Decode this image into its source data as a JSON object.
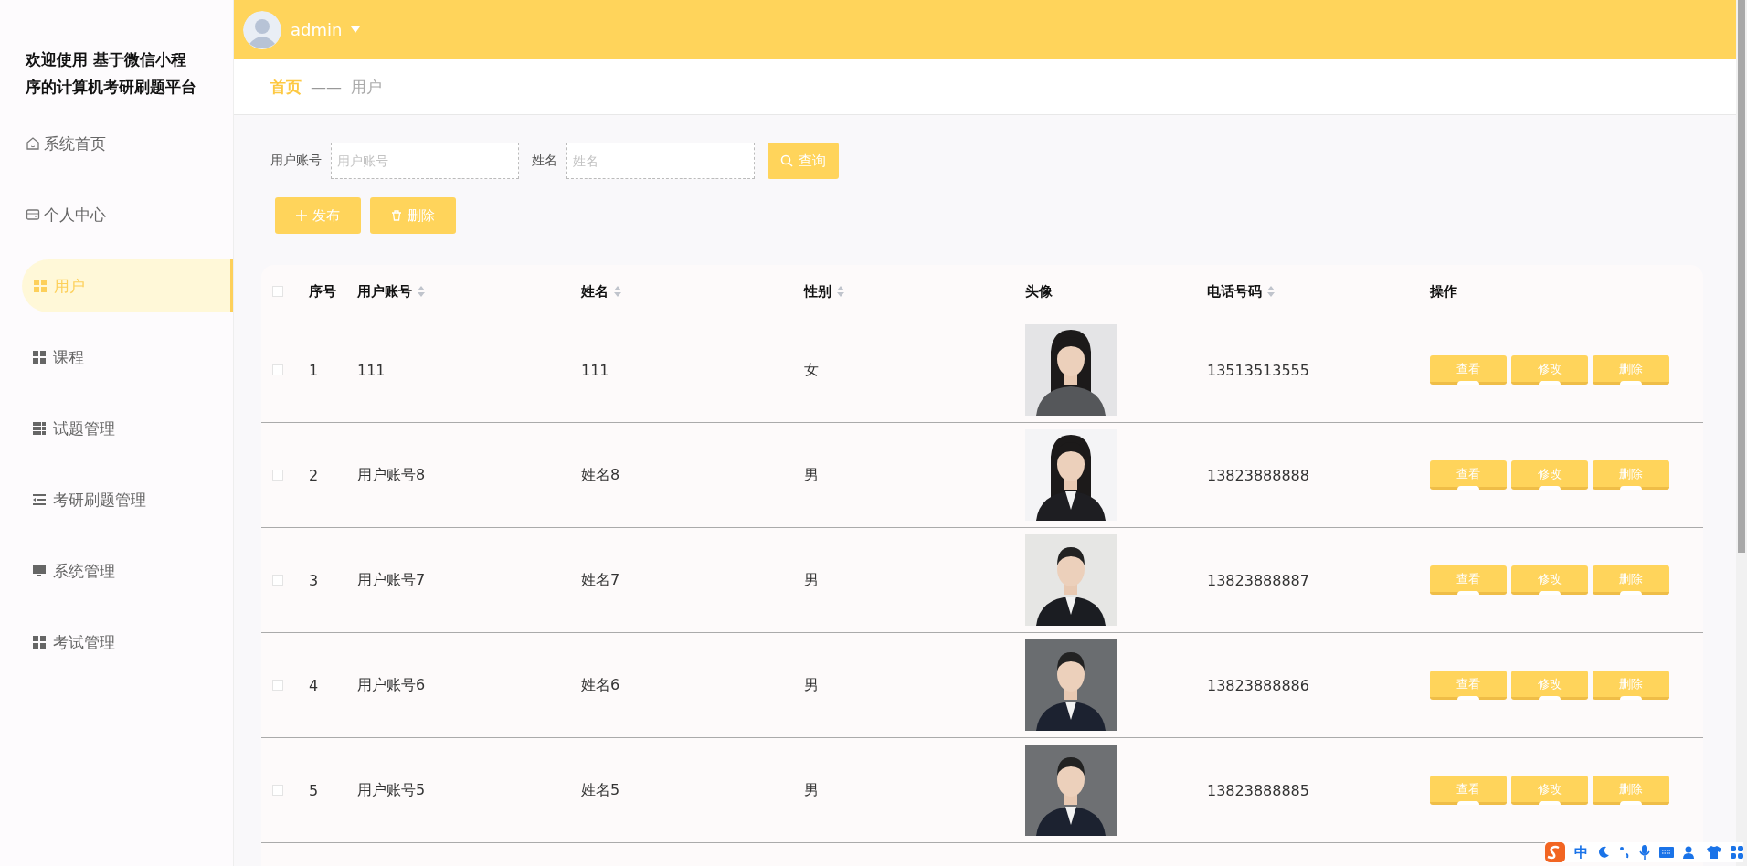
{
  "brand": {
    "title": "欢迎使用 基于微信小程序的计算机考研刷题平台"
  },
  "sidebar": {
    "items": [
      {
        "label": "系统首页",
        "kind": "home",
        "selected": false
      },
      {
        "label": "个人中心",
        "kind": "card",
        "selected": false
      },
      {
        "label": "用户",
        "kind": "grid",
        "selected": true
      },
      {
        "label": "课程",
        "kind": "grid",
        "selected": false
      },
      {
        "label": "试题管理",
        "kind": "grid9",
        "selected": false
      },
      {
        "label": "考研刷题管理",
        "kind": "list",
        "selected": false
      },
      {
        "label": "系统管理",
        "kind": "monitor",
        "selected": false
      },
      {
        "label": "考试管理",
        "kind": "grid",
        "selected": false
      }
    ]
  },
  "header": {
    "user": "admin"
  },
  "breadcrumb": {
    "home": "首页",
    "separator": "——",
    "current": "用户"
  },
  "search": {
    "fields": [
      {
        "label": "用户账号",
        "placeholder": "用户账号"
      },
      {
        "label": "姓名",
        "placeholder": "姓名"
      }
    ],
    "button": "查询"
  },
  "actions": [
    {
      "kind": "add",
      "label": "发布"
    },
    {
      "kind": "delete",
      "label": "删除"
    }
  ],
  "table": {
    "select_all": {
      "checked": false
    },
    "columns": [
      {
        "label": "序号",
        "sortable": false
      },
      {
        "label": "用户账号",
        "sortable": true
      },
      {
        "label": "姓名",
        "sortable": true
      },
      {
        "label": "性别",
        "sortable": true
      },
      {
        "label": "头像",
        "sortable": false
      },
      {
        "label": "电话号码",
        "sortable": true
      },
      {
        "label": "操作",
        "sortable": false
      }
    ],
    "rows": [
      {
        "checked": false,
        "index": "1",
        "account": "111",
        "name": "111",
        "gender": "女",
        "phone": "13513513555",
        "actions": [
          "查看",
          "修改",
          "删除"
        ]
      },
      {
        "checked": false,
        "index": "2",
        "account": "用户账号8",
        "name": "姓名8",
        "gender": "男",
        "phone": "13823888888",
        "actions": [
          "查看",
          "修改",
          "删除"
        ]
      },
      {
        "checked": false,
        "index": "3",
        "account": "用户账号7",
        "name": "姓名7",
        "gender": "男",
        "phone": "13823888887",
        "actions": [
          "查看",
          "修改",
          "删除"
        ]
      },
      {
        "checked": false,
        "index": "4",
        "account": "用户账号6",
        "name": "姓名6",
        "gender": "男",
        "phone": "13823888886",
        "actions": [
          "查看",
          "修改",
          "删除"
        ]
      },
      {
        "checked": false,
        "index": "5",
        "account": "用户账号5",
        "name": "姓名5",
        "gender": "男",
        "phone": "13823888885",
        "actions": [
          "查看",
          "修改",
          "删除"
        ]
      }
    ]
  },
  "ime": {
    "mode": "中"
  }
}
